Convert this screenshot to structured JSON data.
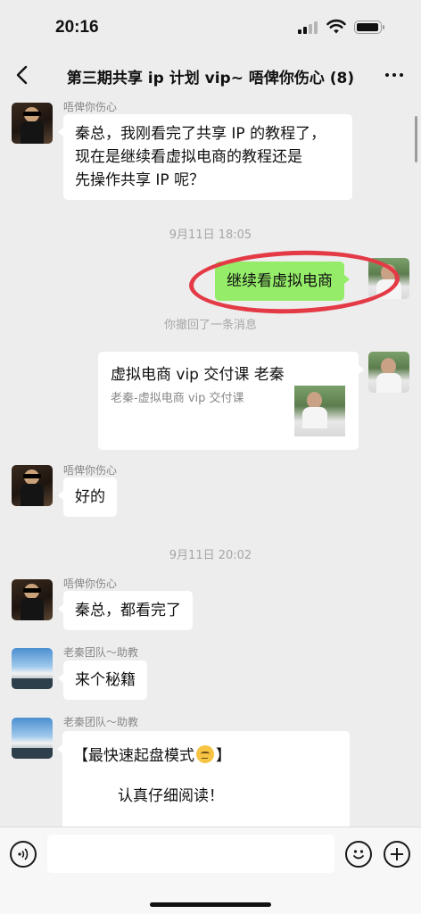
{
  "status_bar": {
    "time": "20:16"
  },
  "header": {
    "title": "第三期共享 ip 计划 vip~ 唔俾你伤心 (8)"
  },
  "messages": [
    {
      "sender": "唔俾你伤心",
      "text": "秦总，我刚看完了共享 IP 的教程了，\n现在是继续看虚拟电商的教程还是\n先操作共享 IP 呢？"
    },
    {
      "timestamp": "9月11日 18:05"
    },
    {
      "self": true,
      "text": "继续看虚拟电商"
    },
    {
      "system": "你撤回了一条消息"
    },
    {
      "card": {
        "title": "虚拟电商 vip 交付课 老秦",
        "subtitle": "老秦-虚拟电商 vip 交付课"
      }
    },
    {
      "sender": "唔俾你伤心",
      "text": "好的"
    },
    {
      "timestamp": "9月11日 20:02"
    },
    {
      "sender": "唔俾你伤心",
      "text": "秦总，都看完了"
    },
    {
      "sender": "老秦团队～助教",
      "text": "来个秘籍"
    },
    {
      "sender": "老秦团队～助教",
      "title": "【最快速起盘模式",
      "title_end": "】",
      "body": "认真仔细阅读！"
    }
  ],
  "input": {
    "placeholder": ""
  },
  "icons": {
    "back": "chevron-left-icon",
    "more": "ellipsis-icon",
    "voice": "voice-icon",
    "emoji": "emoji-icon",
    "plus": "plus-icon"
  },
  "colors": {
    "accent": "#95ec69",
    "background": "#ededed",
    "annotation": "#e33a45"
  }
}
